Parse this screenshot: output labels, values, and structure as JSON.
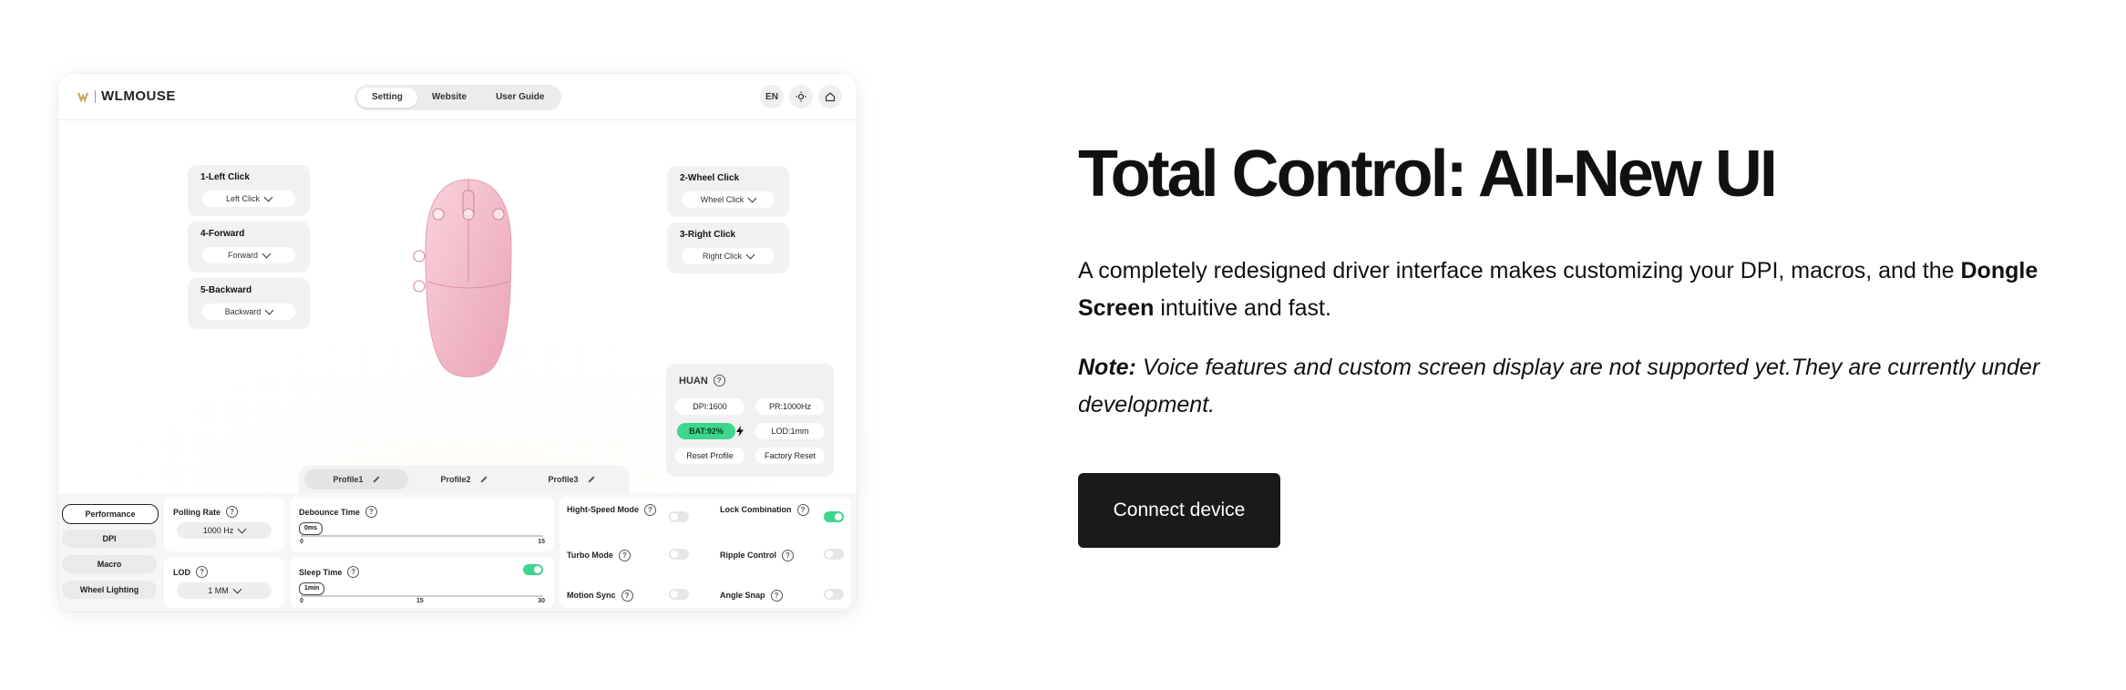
{
  "app": {
    "logo_text": "WLMOUSE",
    "nav_tabs": [
      "Setting",
      "Website",
      "User Guide"
    ],
    "lang_button": "EN",
    "bindings": {
      "left_click": {
        "title": "1-Left Click",
        "value": "Left Click"
      },
      "forward": {
        "title": "4-Forward",
        "value": "Forward"
      },
      "backward": {
        "title": "5-Backward",
        "value": "Backward"
      },
      "wheel_click": {
        "title": "2-Wheel Click",
        "value": "Wheel Click"
      },
      "right_click": {
        "title": "3-Right Click",
        "value": "Right Click"
      }
    },
    "device": {
      "name": "HUAN",
      "dpi": "DPI:1600",
      "polling": "PR:1000Hz",
      "battery": "BAT:92%",
      "lod": "LOD:1mm",
      "reset_profile": "Reset Profile",
      "factory_reset": "Factory Reset"
    },
    "profiles": [
      "Profile1",
      "Profile2",
      "Profile3"
    ],
    "sidebar": [
      "Performance",
      "DPI",
      "Macro",
      "Wheel Lighting"
    ],
    "performance": {
      "polling_rate": {
        "label": "Polling Rate",
        "value": "1000 Hz"
      },
      "lod": {
        "label": "LOD",
        "value": "1 MM"
      },
      "debounce": {
        "label": "Debounce Time",
        "tag": "0ms",
        "min": "0",
        "max": "15"
      },
      "sleep": {
        "label": "Sleep Time",
        "tag": "1min",
        "min": "0",
        "mid": "15",
        "max": "30",
        "enabled": true
      },
      "toggles": {
        "high_speed": {
          "label": "Hight-Speed Mode",
          "on": false
        },
        "lock_combination": {
          "label": "Lock Combination",
          "on": true
        },
        "turbo": {
          "label": "Turbo Mode",
          "on": false
        },
        "ripple": {
          "label": "Ripple Control",
          "on": false
        },
        "motion_sync": {
          "label": "Motion Sync",
          "on": false
        },
        "angle_snap": {
          "label": "Angle Snap",
          "on": false
        }
      }
    },
    "colors": {
      "accent_green": "#3dd68c",
      "mouse_pink": "#f4b8c8"
    }
  },
  "hero": {
    "headline": "Total Control: All-New UI",
    "description_pre": "A completely redesigned driver interface makes customizing your DPI, macros, and the ",
    "description_bold": "Dongle Screen",
    "description_post": " intuitive and fast.",
    "note_label": "Note:",
    "note_text": " Voice features and custom screen display are not supported yet.They are currently under development.",
    "cta_label": "Connect device"
  }
}
